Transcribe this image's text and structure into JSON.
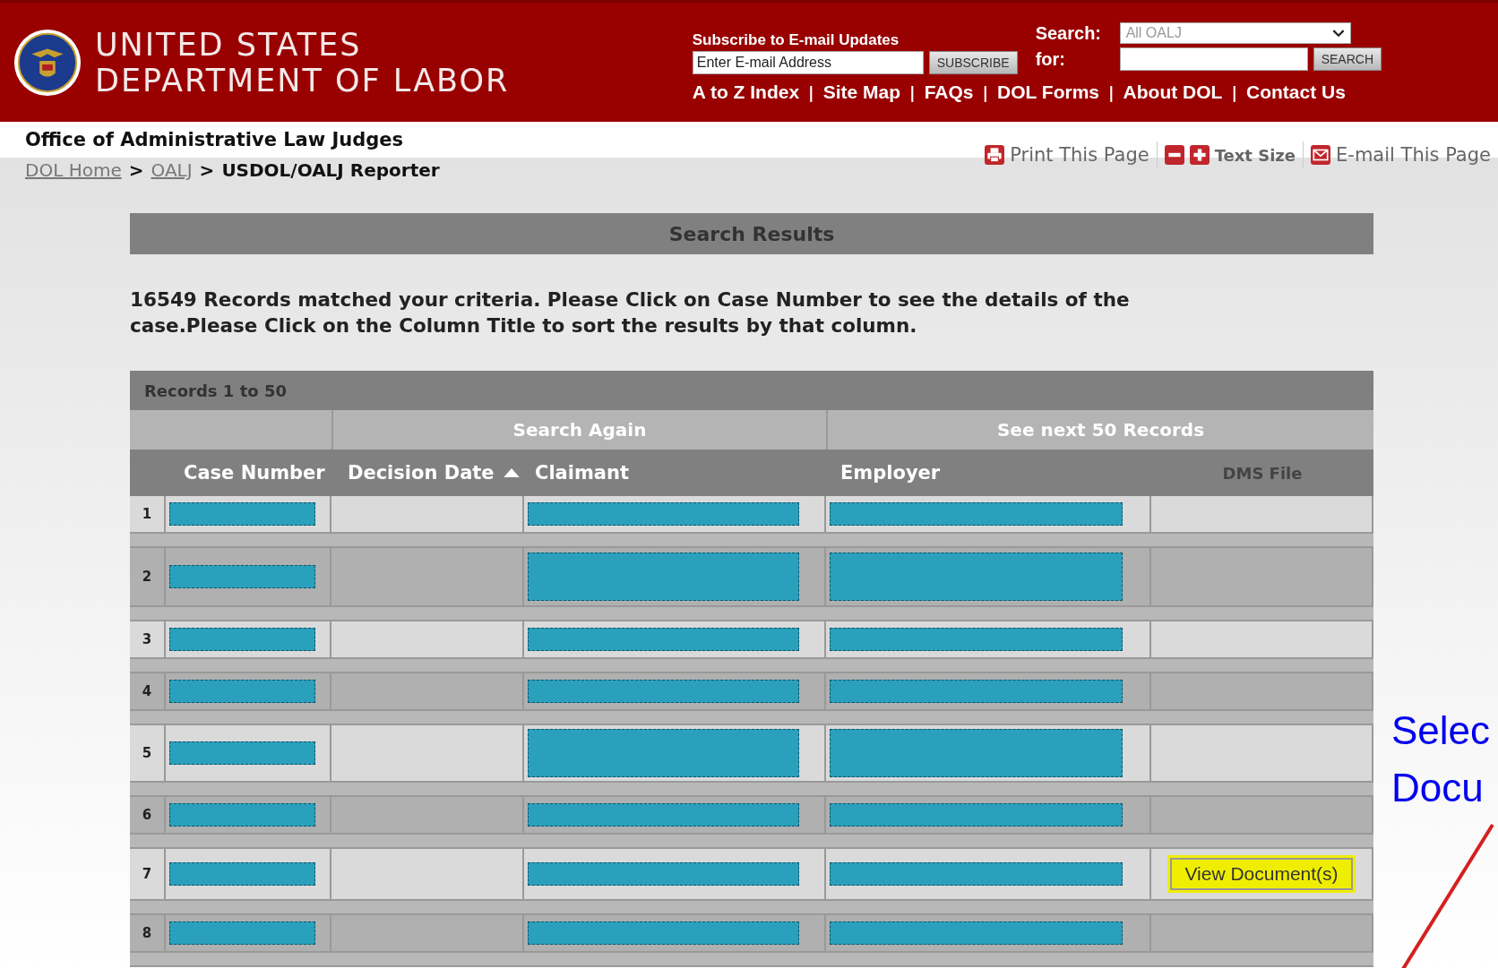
{
  "header": {
    "title_lines": [
      "UNITED STATES",
      "DEPARTMENT OF LABOR"
    ],
    "subscribe": {
      "label": "Subscribe to E-mail Updates",
      "placeholder": "Enter E-mail Address",
      "button": "SUBSCRIBE"
    },
    "search": {
      "label": "Search:",
      "scope": "All OALJ",
      "for_label": "for:",
      "button": "SEARCH"
    },
    "nav_links": [
      "A to Z Index",
      "Site Map",
      "FAQs",
      "DOL Forms",
      "About DOL",
      "Contact Us"
    ],
    "separator": "|"
  },
  "office_title": "Office of Administrative Law Judges",
  "tools": [
    {
      "kind": "print",
      "label": "Print This Page"
    },
    {
      "kind": "textsize",
      "label": "Text Size"
    },
    {
      "kind": "email",
      "label": "E-mail This Page"
    }
  ],
  "breadcrumb": [
    {
      "label": "DOL Home",
      "link": true
    },
    {
      "label": "OALJ",
      "link": true
    },
    {
      "label": "USDOL/OALJ Reporter",
      "link": false
    }
  ],
  "breadcrumb_separator": ">",
  "results_title": "Search Results",
  "summary": "16549 Records matched your criteria. Please Click on Case Number to see the details of the case.Please Click on the Column Title to sort the results by that column.",
  "table": {
    "records_label": "Records 1 to 50",
    "actions": [
      "Search Again",
      "See next 50 Records"
    ],
    "columns": [
      {
        "label": "Case Number",
        "sorted": false
      },
      {
        "label": "Decision Date",
        "sorted": true
      },
      {
        "label": "Claimant",
        "sorted": false
      },
      {
        "label": "Employer",
        "sorted": false
      },
      {
        "label": "DMS File",
        "sorted": false
      }
    ],
    "rows": [
      {
        "number": "1"
      },
      {
        "number": "2"
      },
      {
        "number": "3"
      },
      {
        "number": "4"
      },
      {
        "number": "5"
      },
      {
        "number": "6"
      },
      {
        "number": "7",
        "dms_button": "View Document(s)",
        "highlighted": true
      },
      {
        "number": "8"
      }
    ]
  },
  "annotation": {
    "lines": [
      "Selec",
      "Docu"
    ]
  }
}
